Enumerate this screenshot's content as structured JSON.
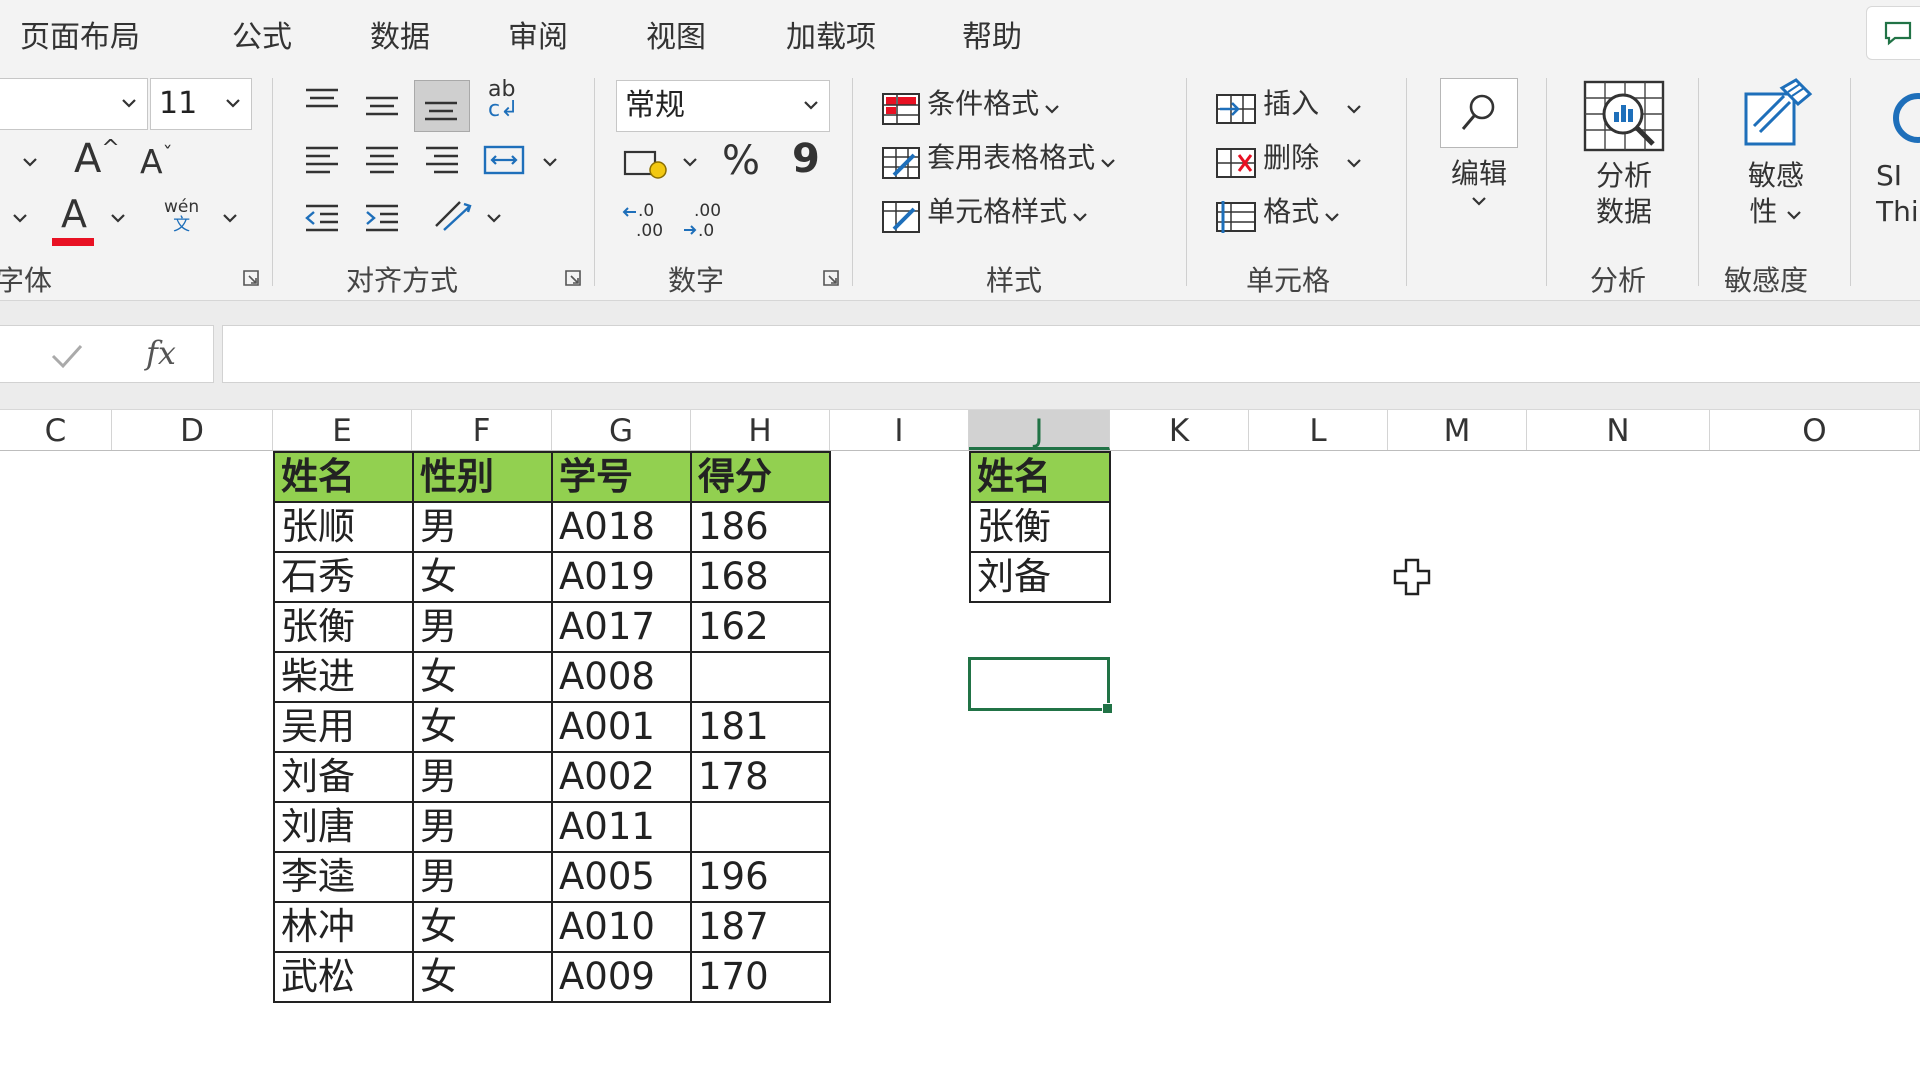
{
  "menu": {
    "tabs": [
      "页面布局",
      "公式",
      "数据",
      "审阅",
      "视图",
      "加载项",
      "帮助"
    ]
  },
  "ribbon": {
    "font": {
      "font_size": "11",
      "grow_label": "A",
      "shrink_label": "A",
      "font_color_label": "A",
      "phonetic_top": "wén",
      "phonetic_bottom": "文",
      "group_label": "字体",
      "font_color": "#e81123"
    },
    "alignment": {
      "group_label": "对齐方式"
    },
    "number": {
      "format": "常规",
      "percent_label": "%",
      "comma_label": "9",
      "group_label": "数字"
    },
    "styles": {
      "conditional_format": "条件格式",
      "format_as_table": "套用表格格式",
      "cell_styles": "单元格样式",
      "group_label": "样式"
    },
    "cells": {
      "insert": "插入",
      "delete": "删除",
      "format": "格式",
      "group_label": "单元格"
    },
    "editing": {
      "label": "编辑"
    },
    "analysis": {
      "label_line1": "分析",
      "label_line2": "数据",
      "group_label": "分析"
    },
    "sensitivity": {
      "label_line1": "敏感",
      "label_line2": "性",
      "group_label": "敏感度"
    },
    "cut_off": {
      "line1": "SI",
      "line2": "Thi"
    }
  },
  "formula_bar": {
    "fx_label": "fx",
    "value": ""
  },
  "columns": [
    "C",
    "D",
    "E",
    "F",
    "G",
    "H",
    "I",
    "J",
    "K",
    "L",
    "M",
    "N",
    "O"
  ],
  "selected_column": "J",
  "main_table": {
    "headers": [
      "姓名",
      "性别",
      "学号",
      "得分"
    ],
    "rows": [
      [
        "张顺",
        "男",
        "A018",
        "186"
      ],
      [
        "石秀",
        "女",
        "A019",
        "168"
      ],
      [
        "张衡",
        "男",
        "A017",
        "162"
      ],
      [
        "柴进",
        "女",
        "A008",
        ""
      ],
      [
        "吴用",
        "女",
        "A001",
        "181"
      ],
      [
        "刘备",
        "男",
        "A002",
        "178"
      ],
      [
        "刘唐",
        "男",
        "A011",
        ""
      ],
      [
        "李逵",
        "男",
        "A005",
        "196"
      ],
      [
        "林冲",
        "女",
        "A010",
        "187"
      ],
      [
        "武松",
        "女",
        "A009",
        "170"
      ]
    ]
  },
  "lookup_table": {
    "header": "姓名",
    "rows": [
      "张衡",
      "刘备"
    ]
  },
  "colors": {
    "header_fill": "#92d050",
    "accent": "#217346"
  }
}
